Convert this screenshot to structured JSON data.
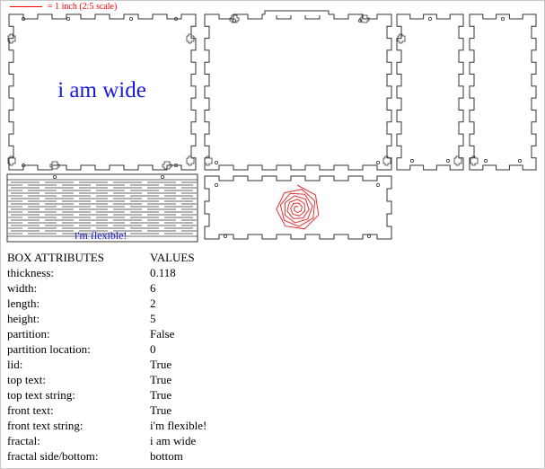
{
  "scale_note": "= 1 inch (2:5 scale)",
  "top_text_string": "i am wide",
  "front_text_string": "i'm flexible!",
  "colors": {
    "cut_line": "#333333",
    "scale": "#ff0000",
    "text": "#1a1adc",
    "fractal": "#e03030"
  },
  "table": {
    "headers": [
      "BOX ATTRIBUTES",
      "VALUES"
    ],
    "rows": [
      [
        "thickness:",
        "0.118"
      ],
      [
        "width:",
        "6"
      ],
      [
        "length:",
        "2"
      ],
      [
        "height:",
        "5"
      ],
      [
        "partition:",
        "False"
      ],
      [
        "partition location:",
        "0"
      ],
      [
        "lid:",
        "True"
      ],
      [
        "top text:",
        "True"
      ],
      [
        "top text string:",
        "True"
      ],
      [
        "front text:",
        "True"
      ],
      [
        "front text string:",
        "i'm flexible!"
      ],
      [
        "fractal:",
        "i am wide"
      ],
      [
        "fractal side/bottom:",
        "bottom"
      ]
    ]
  }
}
